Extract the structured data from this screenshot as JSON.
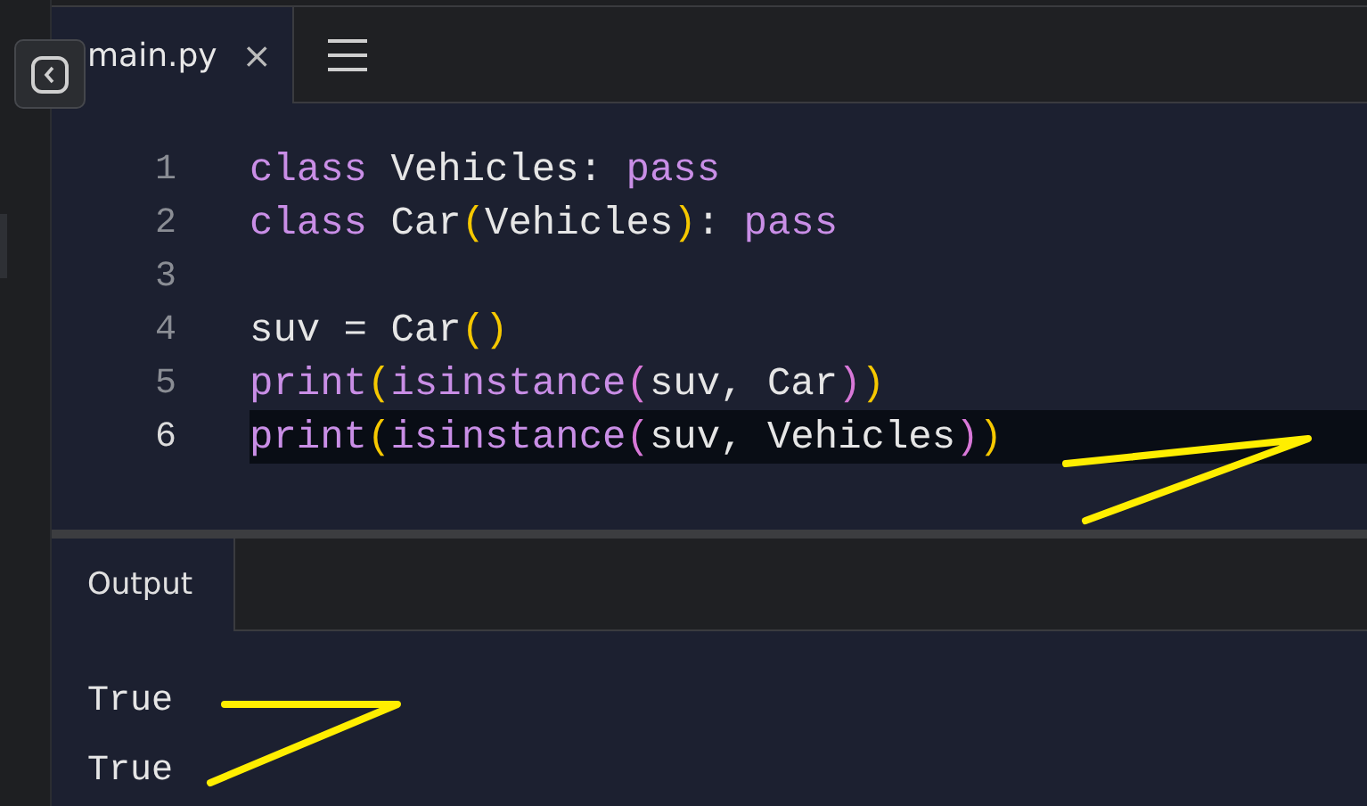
{
  "editor_tabs": [
    {
      "label": "main.py",
      "close": "×",
      "selected": true
    }
  ],
  "code_lines": [
    {
      "number": "1",
      "active": false,
      "tokens": [
        {
          "kind": "keyword",
          "text": "class"
        },
        {
          "kind": "plain",
          "text": " Vehicles: "
        },
        {
          "kind": "keyword",
          "text": "pass"
        }
      ]
    },
    {
      "number": "2",
      "active": false,
      "tokens": [
        {
          "kind": "keyword",
          "text": "class"
        },
        {
          "kind": "plain",
          "text": " Car"
        },
        {
          "kind": "bracket1",
          "text": "("
        },
        {
          "kind": "plain",
          "text": "Vehicles"
        },
        {
          "kind": "bracket1",
          "text": ")"
        },
        {
          "kind": "plain",
          "text": ": "
        },
        {
          "kind": "keyword",
          "text": "pass"
        }
      ]
    },
    {
      "number": "3",
      "active": false
    },
    {
      "number": "4",
      "active": false,
      "tokens": [
        {
          "kind": "plain",
          "text": "suv = Car"
        },
        {
          "kind": "bracket1",
          "text": "()"
        }
      ]
    },
    {
      "number": "5",
      "active": false,
      "tokens": [
        {
          "kind": "keyword",
          "text": "print"
        },
        {
          "kind": "bracket1",
          "text": "("
        },
        {
          "kind": "keyword",
          "text": "isinstance"
        },
        {
          "kind": "bracket2",
          "text": "("
        },
        {
          "kind": "plain",
          "text": "suv, Car"
        },
        {
          "kind": "bracket2",
          "text": ")"
        },
        {
          "kind": "bracket1",
          "text": ")"
        }
      ]
    },
    {
      "number": "6",
      "active": true,
      "tokens": [
        {
          "kind": "keyword",
          "text": "print"
        },
        {
          "kind": "bracket1",
          "text": "("
        },
        {
          "kind": "keyword",
          "text": "isinstance"
        },
        {
          "kind": "bracket2",
          "text": "("
        },
        {
          "kind": "plain",
          "text": "suv, Vehicles"
        },
        {
          "kind": "bracket2",
          "text": ")"
        },
        {
          "kind": "bracket1",
          "text": ")"
        }
      ]
    }
  ],
  "output_tabs": [
    {
      "label": "Output",
      "selected": true
    }
  ],
  "output_lines": [
    "True",
    "True"
  ]
}
